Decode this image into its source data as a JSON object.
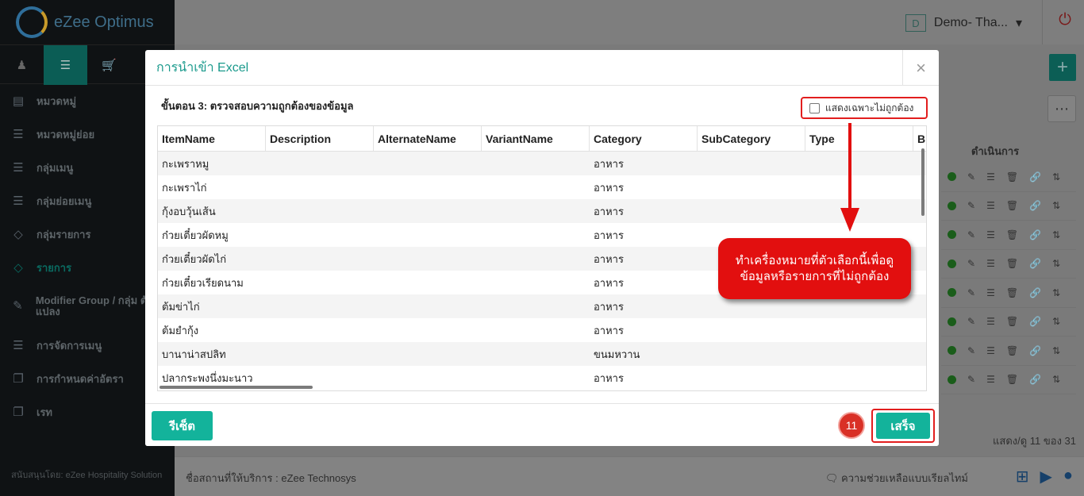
{
  "app": {
    "brand": "eZee Optimus",
    "user_initial": "D",
    "user_name": "Demo- Tha...",
    "sidebar_items": [
      {
        "label": "หมวดหมู่",
        "icon": "category-icon"
      },
      {
        "label": "หมวดหมู่ย่อย",
        "icon": "subcategory-icon"
      },
      {
        "label": "กลุ่มเมนู",
        "icon": "menu-group-icon"
      },
      {
        "label": "กลุ่มย่อยเมนู",
        "icon": "submenu-group-icon"
      },
      {
        "label": "กลุ่มรายการ",
        "icon": "item-group-icon"
      },
      {
        "label": "รายการ",
        "icon": "item-icon"
      },
      {
        "label": "Modifier Group / กลุ่ม ตัดแปลง",
        "icon": "modifier-icon"
      },
      {
        "label": "การจัดการเมนู",
        "icon": "menu-manage-icon"
      },
      {
        "label": "การกำหนดค่าอัตรา",
        "icon": "rate-config-icon"
      },
      {
        "label": "เรท",
        "icon": "rate-icon"
      }
    ],
    "sidebar_footer": "สนับสนุนโดย: eZee Hospitality Solution",
    "action_header": "ดำเนินการ",
    "paging": "แสดง/ดู 11 ของ 31",
    "provider": "ชื่อสถานที่ให้บริการ : eZee Technosys",
    "support": "ความช่วยเหลือแบบเรียลไทม์"
  },
  "modal": {
    "title": "การนำเข้า Excel",
    "step_title": "ขั้นตอน 3: ตรวจสอบความถูกต้องของข้อมูล",
    "only_invalid_label": "แสดงเฉพาะไม่ถูกต้อง",
    "columns": [
      "ItemName",
      "Description",
      "AlternateName",
      "VariantName",
      "Category",
      "SubCategory",
      "Type",
      "B"
    ],
    "rows": [
      [
        "กะเพราหมู",
        "",
        "",
        "",
        "อาหาร",
        "",
        "",
        ""
      ],
      [
        "กะเพราไก่",
        "",
        "",
        "",
        "อาหาร",
        "",
        "",
        ""
      ],
      [
        "กุ้งอบวุ้นเส้น",
        "",
        "",
        "",
        "อาหาร",
        "",
        "",
        ""
      ],
      [
        "ก๋วยเตี๋ยวผัดหมู",
        "",
        "",
        "",
        "อาหาร",
        "",
        "",
        ""
      ],
      [
        "ก๋วยเตี๋ยวผัดไก่",
        "",
        "",
        "",
        "อาหาร",
        "",
        "",
        ""
      ],
      [
        "ก๋วยเตี๋ยวเรียดนาม",
        "",
        "",
        "",
        "อาหาร",
        "",
        "",
        ""
      ],
      [
        "ต้มข่าไก่",
        "",
        "",
        "",
        "อาหาร",
        "",
        "",
        ""
      ],
      [
        "ต้มยำกุ้ง",
        "",
        "",
        "",
        "อาหาร",
        "",
        "",
        ""
      ],
      [
        "บานาน่าสปลิท",
        "",
        "",
        "",
        "ขนมหวาน",
        "",
        "",
        ""
      ],
      [
        "ปลากระพงนึ่งมะนาว",
        "",
        "",
        "",
        "อาหาร",
        "",
        "",
        ""
      ]
    ],
    "reset_label": "รีเซ็ต",
    "done_label": "เสร็จ",
    "step_number": "11",
    "callout_text": "ทำเครื่องหมายที่ตัวเลือกนี้เพื่อดูข้อมูลหรือรายการที่ไม่ถูกต้อง"
  },
  "colors": {
    "accent": "#13b39b",
    "highlight": "#e21e1e"
  }
}
